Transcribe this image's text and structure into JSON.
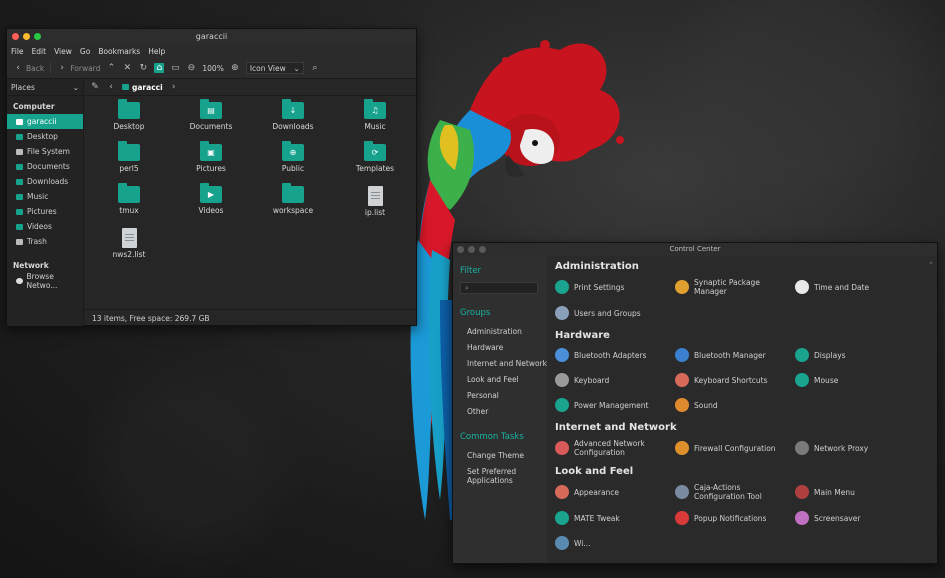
{
  "file_manager": {
    "title": "garaccii",
    "menu": [
      "File",
      "Edit",
      "View",
      "Go",
      "Bookmarks",
      "Help"
    ],
    "toolbar": {
      "back": "Back",
      "forward": "Forward",
      "zoom": "100%",
      "view_mode": "Icon View"
    },
    "places_label": "Places",
    "sidebar": {
      "computer_header": "Computer",
      "items": [
        "garaccii",
        "Desktop",
        "File System",
        "Documents",
        "Downloads",
        "Music",
        "Pictures",
        "Videos",
        "Trash"
      ],
      "network_header": "Network",
      "network_items": [
        "Browse Netwo..."
      ]
    },
    "path_crumb": "garacci",
    "items": [
      {
        "name": "Desktop",
        "kind": "folder",
        "glyph": ""
      },
      {
        "name": "Documents",
        "kind": "folder",
        "glyph": "▤"
      },
      {
        "name": "Downloads",
        "kind": "folder",
        "glyph": "↓"
      },
      {
        "name": "Music",
        "kind": "folder",
        "glyph": "♫"
      },
      {
        "name": "perl5",
        "kind": "folder",
        "glyph": ""
      },
      {
        "name": "Pictures",
        "kind": "folder",
        "glyph": "▣"
      },
      {
        "name": "Public",
        "kind": "folder",
        "glyph": "⊕"
      },
      {
        "name": "Templates",
        "kind": "folder",
        "glyph": "⟳"
      },
      {
        "name": "tmux",
        "kind": "folder",
        "glyph": ""
      },
      {
        "name": "Videos",
        "kind": "folder",
        "glyph": "▶"
      },
      {
        "name": "workspace",
        "kind": "folder",
        "glyph": ""
      },
      {
        "name": "ip.list",
        "kind": "file",
        "glyph": ""
      },
      {
        "name": "nws2.list",
        "kind": "file",
        "glyph": ""
      }
    ],
    "status": "13 items, Free space: 269.7 GB"
  },
  "control_center": {
    "title": "Control Center",
    "filter_header": "Filter",
    "groups_header": "Groups",
    "groups": [
      "Administration",
      "Hardware",
      "Internet and Network",
      "Look and Feel",
      "Personal",
      "Other"
    ],
    "tasks_header": "Common Tasks",
    "tasks": [
      "Change Theme",
      "Set Preferred Applications"
    ],
    "sections": [
      {
        "title": "Administration",
        "rows": [
          [
            {
              "label": "Print Settings",
              "color": "#1aa38e"
            },
            {
              "label": "Synaptic Package Manager",
              "color": "#e0a030"
            },
            {
              "label": "Time and Date",
              "color": "#e8e8e8"
            }
          ],
          [
            {
              "label": "Users and Groups",
              "color": "#8aa0b8"
            }
          ]
        ]
      },
      {
        "title": "Hardware",
        "rows": [
          [
            {
              "label": "Bluetooth Adapters",
              "color": "#4a8fd8"
            },
            {
              "label": "Bluetooth Manager",
              "color": "#3a7fd0"
            },
            {
              "label": "Displays",
              "color": "#1aa38e"
            }
          ],
          [
            {
              "label": "Keyboard",
              "color": "#9a9a9a"
            },
            {
              "label": "Keyboard Shortcuts",
              "color": "#d86a5a"
            },
            {
              "label": "Mouse",
              "color": "#1aa38e"
            }
          ],
          [
            {
              "label": "Power Management",
              "color": "#1aa38e"
            },
            {
              "label": "Sound",
              "color": "#e08a30"
            }
          ]
        ]
      },
      {
        "title": "Internet and Network",
        "rows": [
          [
            {
              "label": "Advanced Network Configuration",
              "color": "#d85a5a"
            },
            {
              "label": "Firewall Configuration",
              "color": "#e0902a"
            },
            {
              "label": "Network Proxy",
              "color": "#7a7a7a"
            }
          ]
        ]
      },
      {
        "title": "Look and Feel",
        "rows": [
          [
            {
              "label": "Appearance",
              "color": "#d86a5a"
            },
            {
              "label": "Caja-Actions Configuration Tool",
              "color": "#7a8aa0"
            },
            {
              "label": "Main Menu",
              "color": "#b04040"
            }
          ],
          [
            {
              "label": "MATE Tweak",
              "color": "#1aa38e"
            },
            {
              "label": "Popup Notifications",
              "color": "#d83a3a"
            },
            {
              "label": "Screensaver",
              "color": "#c070c0"
            }
          ],
          [
            {
              "label": "Wi...",
              "color": "#5a8ab0"
            }
          ]
        ]
      }
    ]
  }
}
